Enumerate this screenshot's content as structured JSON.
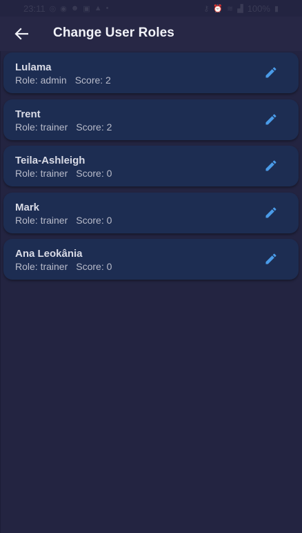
{
  "status_bar": {
    "time": "23:11",
    "left_icons": [
      "whatsapp-icon",
      "messenger-icon",
      "face-icon",
      "image-icon",
      "sim-icon",
      "dot-icon"
    ],
    "right_icons": [
      "key-icon",
      "alarm-icon",
      "wifi-icon",
      "signal-icon"
    ],
    "battery": "100%"
  },
  "app_bar": {
    "title": "Change User Roles",
    "back_icon": "arrow-back-icon"
  },
  "colors": {
    "background": "#232441",
    "card": "#1d2d52",
    "accent": "#4a9be8",
    "title": "#f1f2f8"
  },
  "users": [
    {
      "name": "Lulama",
      "role": "Role: admin",
      "score": "Score: 2"
    },
    {
      "name": "Trent",
      "role": "Role: trainer",
      "score": "Score: 2"
    },
    {
      "name": "Teila-Ashleigh",
      "role": "Role: trainer",
      "score": "Score: 0"
    },
    {
      "name": "Mark",
      "role": "Role: trainer",
      "score": "Score: 0"
    },
    {
      "name": "Ana Leokânia",
      "role": "Role: trainer",
      "score": "Score: 0"
    }
  ]
}
